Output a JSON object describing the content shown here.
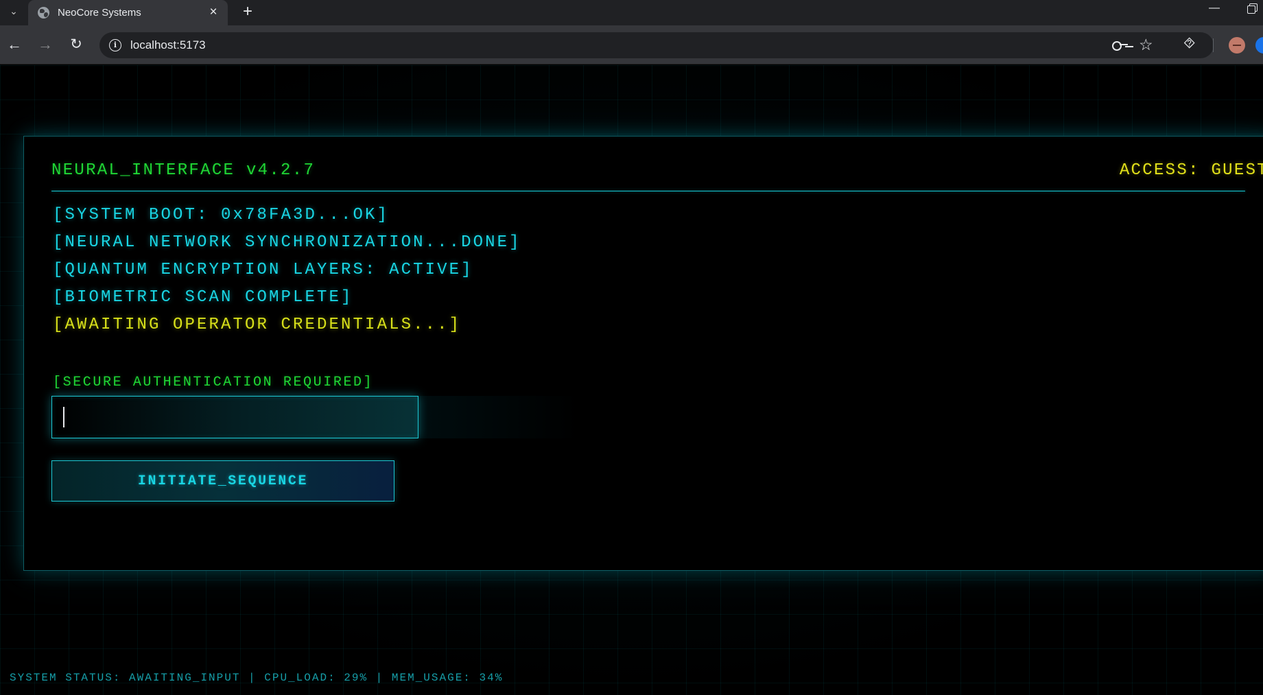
{
  "browser": {
    "tab_title": "NeoCore Systems",
    "url": "localhost:5173"
  },
  "terminal": {
    "title": "NEURAL_INTERFACE v4.2.7",
    "access": "ACCESS: GUEST",
    "boot_lines": [
      "[SYSTEM BOOT: 0x78FA3D...OK]",
      "[NEURAL NETWORK SYNCHRONIZATION...DONE]",
      "[QUANTUM ENCRYPTION LAYERS: ACTIVE]",
      "[BIOMETRIC SCAN COMPLETE]",
      "[AWAITING OPERATOR CREDENTIALS...]"
    ],
    "auth_label": "[SECURE AUTHENTICATION REQUIRED]",
    "auth_value": "",
    "button_label": "INITIATE_SEQUENCE"
  },
  "status_bar": "SYSTEM STATUS: AWAITING_INPUT | CPU_LOAD: 29% | MEM_USAGE: 34%",
  "colors": {
    "primary_cyan": "#19d5e3",
    "terminal_green": "#1fd635",
    "warning_yellow": "#e1e01a",
    "status_teal": "#169ea8",
    "background": "#000000"
  },
  "icons": {
    "tab_menu": "chevron-down-icon",
    "favicon": "globe-icon",
    "close": "close-icon",
    "new_tab": "plus-icon",
    "back": "arrow-left-icon",
    "forward": "arrow-right-icon",
    "reload": "reload-icon",
    "site_info": "info-icon",
    "password": "key-icon",
    "bookmark": "star-icon",
    "extensions": "puzzle-icon",
    "profile": "avatar-icon"
  }
}
